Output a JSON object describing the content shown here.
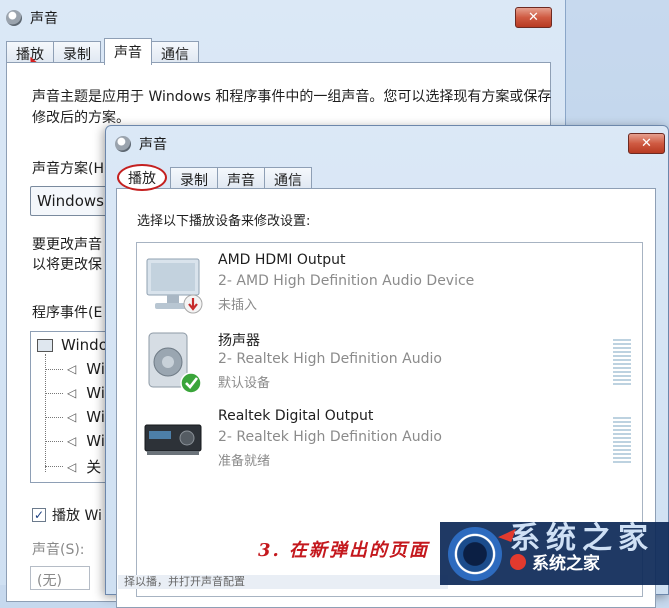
{
  "back_window": {
    "title": "声音",
    "close_glyph": "✕",
    "tabs": [
      {
        "label": "播放",
        "active": false
      },
      {
        "label": "录制",
        "active": false
      },
      {
        "label": "声音",
        "active": true
      },
      {
        "label": "通信",
        "active": false
      }
    ],
    "description": "声音主题是应用于 Windows 和程序事件中的一组声音。您可以选择现有方案或保存修改后的方案。",
    "scheme_label": "声音方案(H",
    "scheme_value": "Windows",
    "change_text_line1": "要更改声音",
    "change_text_line2": "以将更改保",
    "events_label": "程序事件(E",
    "tree_root": "Windo",
    "tree_items": [
      "Wi",
      "Wi",
      "Wi",
      "Wi",
      "关"
    ],
    "play_checkbox_label": "播放 Wi",
    "play_checked": true,
    "sounds_label": "声音(S):",
    "sounds_value": "(无)"
  },
  "front_window": {
    "title": "声音",
    "close_glyph": "✕",
    "tabs": [
      {
        "label": "播放",
        "active": true
      },
      {
        "label": "录制",
        "active": false
      },
      {
        "label": "声音",
        "active": false
      },
      {
        "label": "通信",
        "active": false
      }
    ],
    "instruction": "选择以下播放设备来修改设置:",
    "devices": [
      {
        "name": "AMD HDMI Output",
        "sub": "2- AMD High Definition Audio Device",
        "status": "未插入",
        "icon": "monitor-icon",
        "badge": "unplugged-badge-icon"
      },
      {
        "name": "扬声器",
        "sub": "2- Realtek High Definition Audio",
        "status": "默认设备",
        "icon": "speaker-icon",
        "badge": "default-check-badge-icon"
      },
      {
        "name": "Realtek Digital Output",
        "sub": "2- Realtek High Definition Audio",
        "status": "准备就绪",
        "icon": "receiver-icon",
        "badge": ""
      }
    ]
  },
  "caption": "3. 在新弹出的页面",
  "bottom_strip_text": "择以播，并打开声音配置",
  "watermark": {
    "text": "系统之家",
    "top_text": "系统之家"
  },
  "colors": {
    "accent_red": "#c4181d",
    "close_red": "#c9503a",
    "window_blue": "#d3e3f4",
    "check_green": "#3aa53a"
  }
}
